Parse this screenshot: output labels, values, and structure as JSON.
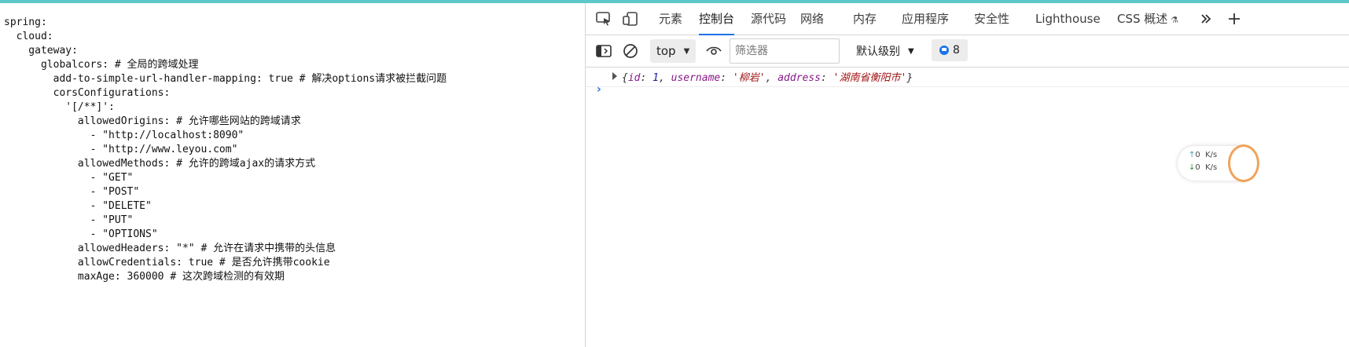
{
  "yaml": {
    "lines": [
      "spring:",
      "  cloud:",
      "    gateway:",
      "      globalcors: # 全局的跨域处理",
      "        add-to-simple-url-handler-mapping: true # 解决options请求被拦截问题",
      "        corsConfigurations:",
      "          '[/**]':",
      "            allowedOrigins: # 允许哪些网站的跨域请求",
      "              - \"http://localhost:8090\"",
      "              - \"http://www.leyou.com\"",
      "            allowedMethods: # 允许的跨域ajax的请求方式",
      "              - \"GET\"",
      "              - \"POST\"",
      "              - \"DELETE\"",
      "              - \"PUT\"",
      "              - \"OPTIONS\"",
      "            allowedHeaders: \"*\" # 允许在请求中携带的头信息",
      "            allowCredentials: true # 是否允许携带cookie",
      "            maxAge: 360000 # 这次跨域检测的有效期"
    ]
  },
  "devtools": {
    "tabs": [
      "元素",
      "控制台",
      "源代码",
      "网络",
      "内存",
      "应用程序",
      "安全性",
      "Lighthouse",
      "CSS 概述"
    ],
    "active_tab": "控制台",
    "context": "top",
    "filter_placeholder": "筛选器",
    "log_level": "默认级别",
    "issues_count": "8",
    "console": {
      "object": {
        "id_key": "id",
        "id_val": "1",
        "username_key": "username",
        "username_val": "'柳岩'",
        "address_key": "address",
        "address_val": "'湖南省衡阳市'"
      }
    }
  },
  "net_widget": {
    "up_value": "0",
    "down_value": "0",
    "unit": "K/s"
  },
  "colors": {
    "accent": "#1a73e8",
    "top_strip": "#5dc6c8"
  }
}
